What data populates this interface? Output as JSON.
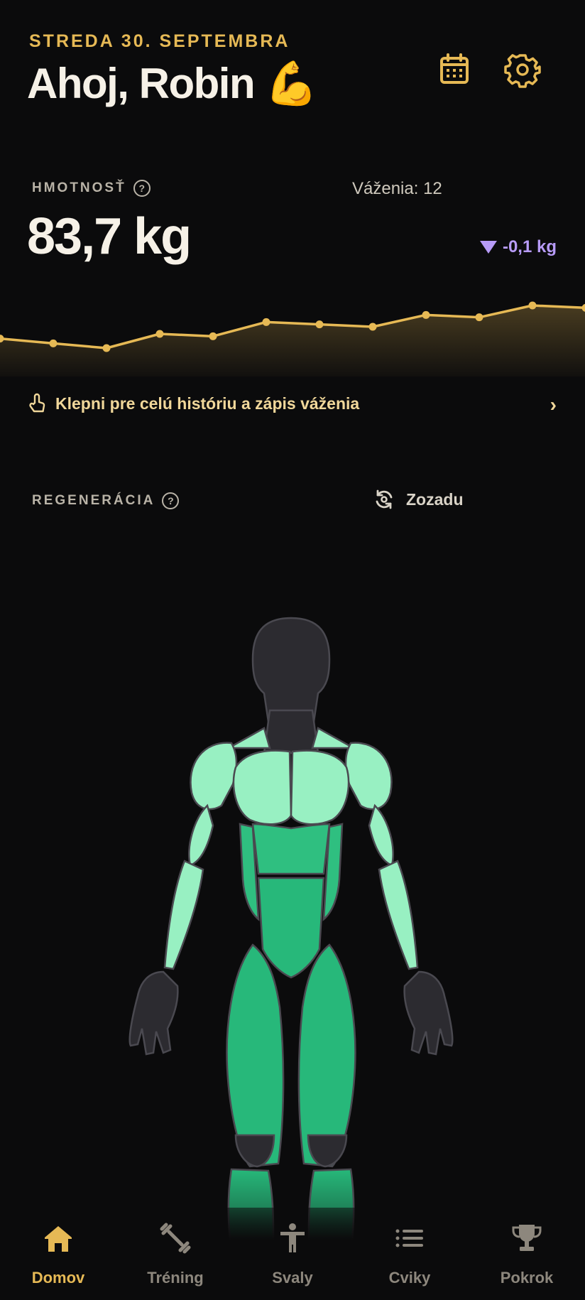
{
  "header": {
    "date": "STREDA 30. SEPTEMBRA",
    "greeting": "Ahoj, Robin 💪",
    "calendar_icon": "calendar-icon",
    "settings_icon": "gear-icon"
  },
  "weight": {
    "label": "HMOTNOSŤ",
    "help": "?",
    "count": "Váženia: 12",
    "value": "83,7 kg",
    "delta": "-0,1 kg",
    "history_link": "Klepni pre celú históriu a zápis váženia",
    "chart_values": [
      84.2,
      84.1,
      84.0,
      84.3,
      84.25,
      84.55,
      84.5,
      84.45,
      84.7,
      84.65,
      84.9,
      84.85
    ]
  },
  "regeneration": {
    "label": "REGENERÁCIA",
    "help": "?",
    "view_toggle": "Zozadu"
  },
  "nav": {
    "items": [
      {
        "label": "Domov",
        "icon": "home-icon",
        "active": true
      },
      {
        "label": "Tréning",
        "icon": "dumbbell-icon",
        "active": false
      },
      {
        "label": "Svaly",
        "icon": "body-icon",
        "active": false
      },
      {
        "label": "Cviky",
        "icon": "list-icon",
        "active": false
      },
      {
        "label": "Pokrok",
        "icon": "trophy-icon",
        "active": false
      }
    ]
  },
  "colors": {
    "accent": "#e6b955",
    "decrease": "#b79bf7",
    "muscle_light": "#98f0c2",
    "muscle_mid": "#4fd69a",
    "muscle_dark": "#27b87a",
    "skin": "#2c2b30"
  }
}
